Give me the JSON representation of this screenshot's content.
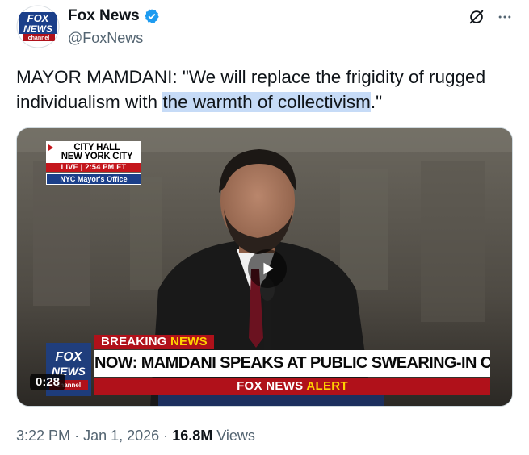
{
  "author": {
    "display_name": "Fox News",
    "handle": "@FoxNews",
    "avatar_text": {
      "top": "FOX",
      "middle": "NEWS",
      "bottom": "channel"
    },
    "verified": true
  },
  "icons": {
    "grok": "grok-icon",
    "more": "more-horizontal-icon",
    "verified": "verified-badge-icon",
    "play": "play-icon"
  },
  "tweet": {
    "text_plain": "MAYOR MAMDANI: \"We will replace the frigidity of rugged individualism with ",
    "text_highlight": "the warmth of collectivism",
    "text_end": ".\""
  },
  "video": {
    "location": {
      "line1": "CITY HALL",
      "line2": "NEW YORK CITY",
      "live": "LIVE",
      "time": "2:54 PM ET",
      "source": "NYC Mayor's Office"
    },
    "breaking_label": "BREAKING",
    "breaking_news_word": "NEWS",
    "headline": "NOW: MAMDANI SPEAKS AT PUBLIC SWEARING-IN CEREMONY",
    "alert_brand": "FOX NEWS",
    "alert_word": "ALERT",
    "duration": "0:28",
    "bug_text": {
      "top": "FOX",
      "middle": "NEWS",
      "bottom": "channel"
    }
  },
  "meta": {
    "time": "3:22 PM",
    "separator": "·",
    "date": "Jan 1, 2026",
    "views_count": "16.8M",
    "views_label": "Views"
  },
  "colors": {
    "accent": "#1d9bf0",
    "highlight": "#c6dbf7",
    "fox_red": "#b0111a",
    "fox_blue": "#1b3f8a",
    "muted": "#536471"
  }
}
